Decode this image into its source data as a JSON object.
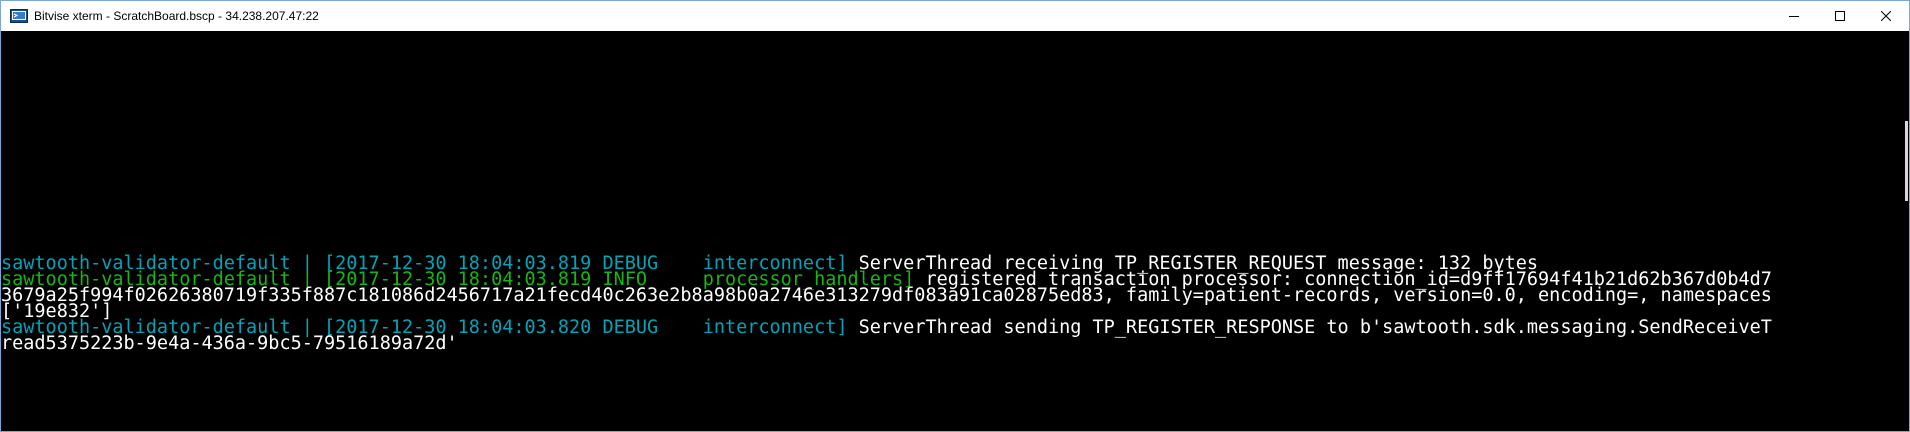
{
  "window": {
    "title": "Bitvise xterm - ScratchBoard.bscp - 34.238.207.47:22"
  },
  "colors": {
    "cyan": "#00a4b8",
    "green": "#15b615",
    "white": "#ffffff",
    "background": "#000000"
  },
  "terminal": {
    "lines": [
      {
        "prefix": "sawtooth-validator-default | [2017-12-30 18:04:03.819 DEBUG    interconnect] ",
        "text": "ServerThread receiving TP_REGISTER_REQUEST message: 132 bytes"
      },
      {
        "prefix": "sawtooth-validator-default | [2017-12-30 18:04:03.819 INFO     processor_handlers] ",
        "text": "registered transaction processor: connection_id=d9ff17694f41b21d62b367d0b4d7"
      },
      {
        "prefix": "",
        "text": "3679a25f994f02626380719f335f887c181086d2456717a21fecd40c263e2b8a98b0a2746e313279df083a91ca02875ed83, family=patient-records, version=0.0, encoding=, namespaces"
      },
      {
        "prefix": "",
        "text": "['19e832']"
      },
      {
        "prefix": "sawtooth-validator-default | [2017-12-30 18:04:03.820 DEBUG    interconnect] ",
        "text": "ServerThread sending TP_REGISTER_RESPONSE to b'sawtooth.sdk.messaging.SendReceiveT"
      },
      {
        "prefix": "",
        "text": "read5375223b-9e4a-436a-9bc5-79516189a72d'"
      }
    ]
  }
}
